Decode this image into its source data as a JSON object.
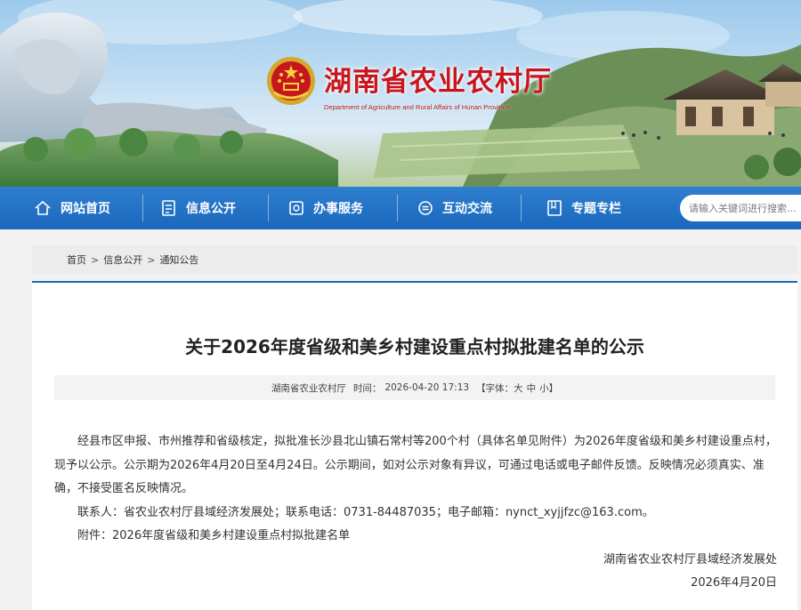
{
  "header": {
    "title": "湖南省农业农村厅",
    "subtitle": "Department of Agriculture and Rural Affairs of Hunan Province",
    "colors": {
      "brand_red": "#c8161d",
      "nav_blue": "#1a67bb"
    }
  },
  "nav": {
    "items": [
      {
        "label": "网站首页",
        "icon": "home-icon"
      },
      {
        "label": "信息公开",
        "icon": "document-icon"
      },
      {
        "label": "办事服务",
        "icon": "service-icon"
      },
      {
        "label": "互动交流",
        "icon": "chat-icon"
      },
      {
        "label": "专题专栏",
        "icon": "bookmark-icon"
      }
    ],
    "search_placeholder": "请输入关键词进行搜索..."
  },
  "breadcrumb": [
    "首页",
    "信息公开",
    "通知公告"
  ],
  "article": {
    "title": "关于2026年度省级和美乡村建设重点村拟批建名单的公示",
    "meta": {
      "source": "湖南省农业农村厅",
      "time_label": "时间：",
      "time": "2026-04-20 17:13",
      "font_open": "【字体：",
      "font_large": "大",
      "font_medium": "中",
      "font_small": "小",
      "font_close": "】"
    },
    "paragraphs": {
      "p1": "经县市区申报、市州推荐和省级核定，拟批准长沙县北山镇石常村等200个村（具体名单见附件）为2026年度省级和美乡村建设重点村，现予以公示。公示期为2026年4月20日至4月24日。公示期间，如对公示对象有异议，可通过电话或电子邮件反馈。反映情况必须真实、准确，不接受匿名反映情况。",
      "contact": "联系人：省农业农村厅县域经济发展处；联系电话：0731-84487035；电子邮箱：nynct_xyjjfzc@163.com。",
      "attachment_label": "附件：",
      "attachment_link": "2026年度省级和美乡村建设重点村拟批建名单"
    },
    "signature": {
      "org": "湖南省农业农村厅县域经济发展处",
      "date": "2026年4月20日"
    }
  }
}
